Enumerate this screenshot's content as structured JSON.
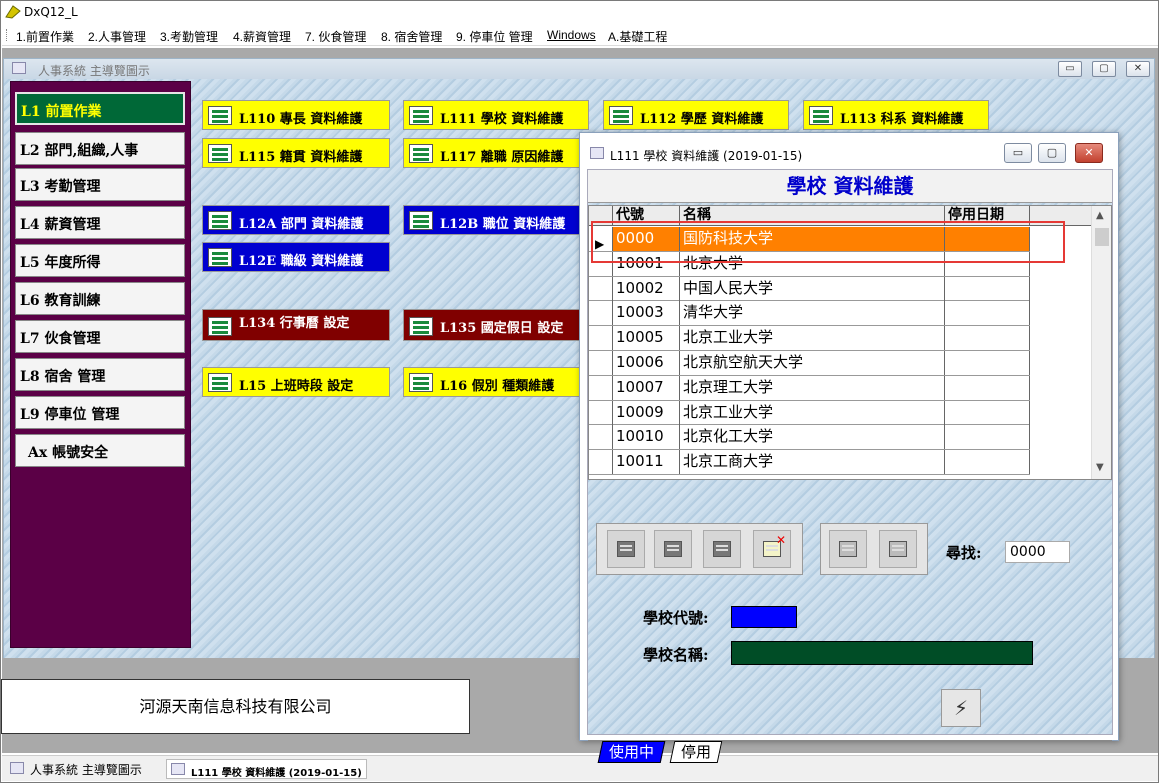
{
  "app": {
    "title": "DxQ12_L"
  },
  "menu": [
    "1.前置作業",
    "2.人事管理",
    "3.考勤管理",
    "4.薪資管理",
    "7. 伙食管理",
    "8. 宿舍管理",
    "9. 停車位 管理",
    "Windows",
    "A.基礎工程"
  ],
  "main_window": {
    "title": "人事系統 主導覽圖示",
    "min": "▭",
    "max": "▢",
    "close": "✕"
  },
  "left_nav": [
    "L1 前置作業",
    "L2 部門,組織,人事",
    "L3 考勤管理",
    "L4 薪資管理",
    "L5 年度所得",
    "L6 教育訓練",
    "L7 伙食管理",
    "L8 宿舍 管理",
    "L9 停車位 管理",
    "Ax 帳號安全"
  ],
  "modules": {
    "l110": "L110 專長 資料維護",
    "l111": "L111 學校 資料維護",
    "l112": "L112 學歷 資料維護",
    "l113": "L113 科系 資料維護",
    "l115": "L115 籍貫 資料維護",
    "l117": "L117 離職 原因維護",
    "l12a": "L12A 部門 資料維護",
    "l12b": "L12B 職位 資料維護",
    "l12e": "L12E 職級 資料維護",
    "l134": "L134 行事曆 設定",
    "l135": "L135 國定假日 設定",
    "l15": "L15 上班時段 設定",
    "l16": "L16 假別 種類維護"
  },
  "company": "河源天南信息科技有限公司",
  "taskbar": {
    "item1": "人事系統 主導覽圖示",
    "item2": "L111 學校 資料維護 (2019-01-15)"
  },
  "dialog": {
    "title": "L111 學校 資料維護 (2019-01-15)",
    "min": "▭",
    "max": "▢",
    "close": "✕",
    "header": "學校 資料維護",
    "columns": [
      "代號",
      "名稱",
      "停用日期"
    ],
    "rows": [
      {
        "code": "0000",
        "name": "国防科技大学",
        "date": ""
      },
      {
        "code": "10001",
        "name": "北京大学",
        "date": ""
      },
      {
        "code": "10002",
        "name": "中国人民大学",
        "date": ""
      },
      {
        "code": "10003",
        "name": "清华大学",
        "date": ""
      },
      {
        "code": "10005",
        "name": "北京工业大学",
        "date": ""
      },
      {
        "code": "10006",
        "name": "北京航空航天大学",
        "date": ""
      },
      {
        "code": "10007",
        "name": "北京理工大学",
        "date": ""
      },
      {
        "code": "10009",
        "name": "北京工业大学",
        "date": ""
      },
      {
        "code": "10010",
        "name": "北京化工大学",
        "date": ""
      },
      {
        "code": "10011",
        "name": "北京工商大学",
        "date": ""
      }
    ],
    "row_indicator": "▶",
    "scroll_up": "▲",
    "scroll_down": "▼",
    "find_label": "尋找:",
    "find_value": "0000",
    "code_label": "學校代號:",
    "name_label": "學校名稱:",
    "save_glyph": "⚡",
    "delete_glyph": "✕",
    "tabs": [
      "使用中",
      "停用"
    ]
  }
}
